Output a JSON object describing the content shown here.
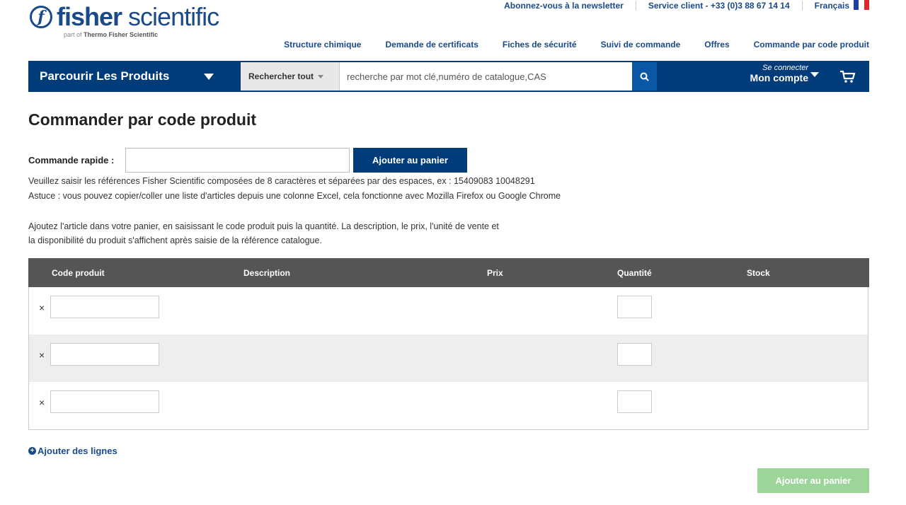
{
  "logo": {
    "word_bold": "fisher",
    "word_light": " scientific",
    "sub_prefix": "part of ",
    "sub_brand": "Thermo Fisher Scientific"
  },
  "util": {
    "newsletter": "Abonnez-vous à la newsletter",
    "service": "Service client - +33 (0)3 88 67 14 14",
    "language": "Français"
  },
  "nav": [
    "Structure chimique",
    "Demande de certificats",
    "Fiches de sécurité",
    "Suivi de commande",
    "Offres",
    "Commande par code produit"
  ],
  "bluebar": {
    "browse": "Parcourir Les Produits",
    "scope": "Rechercher tout",
    "search_placeholder": "recherche par mot clé,numéro de catalogue,CAS",
    "signin": "Se connecter",
    "account": "Mon compte"
  },
  "page": {
    "title": "Commander par code produit",
    "quick_label": "Commande rapide :",
    "add_cart": "Ajouter au panier",
    "help1": "Veuillez saisir les références Fisher Scientific composées de 8 caractères et séparées par des espaces, ex : 15409083 10048291",
    "help2": "Astuce : vous pouvez copier/coller une liste d'articles depuis une colonne Excel, cela fonctionne avec Mozilla Firefox ou Google Chrome",
    "help3": "Ajoutez l'article dans votre panier, en saisissant le code produit puis la quantité. La description, le prix, l'unité de vente et",
    "help4": "la disponibilité du produit s'affichent après saisie de la référence catalogue."
  },
  "table": {
    "headers": {
      "code": "Code produit",
      "description": "Description",
      "price": "Prix",
      "qty": "Quantité",
      "stock": "Stock"
    },
    "remove_glyph": "×"
  },
  "add_lines": "Ajouter des lignes",
  "colors": {
    "brand": "#003b7a",
    "link": "#1a4a8a",
    "header_gray": "#555555",
    "disabled_green": "#9dd49a"
  }
}
